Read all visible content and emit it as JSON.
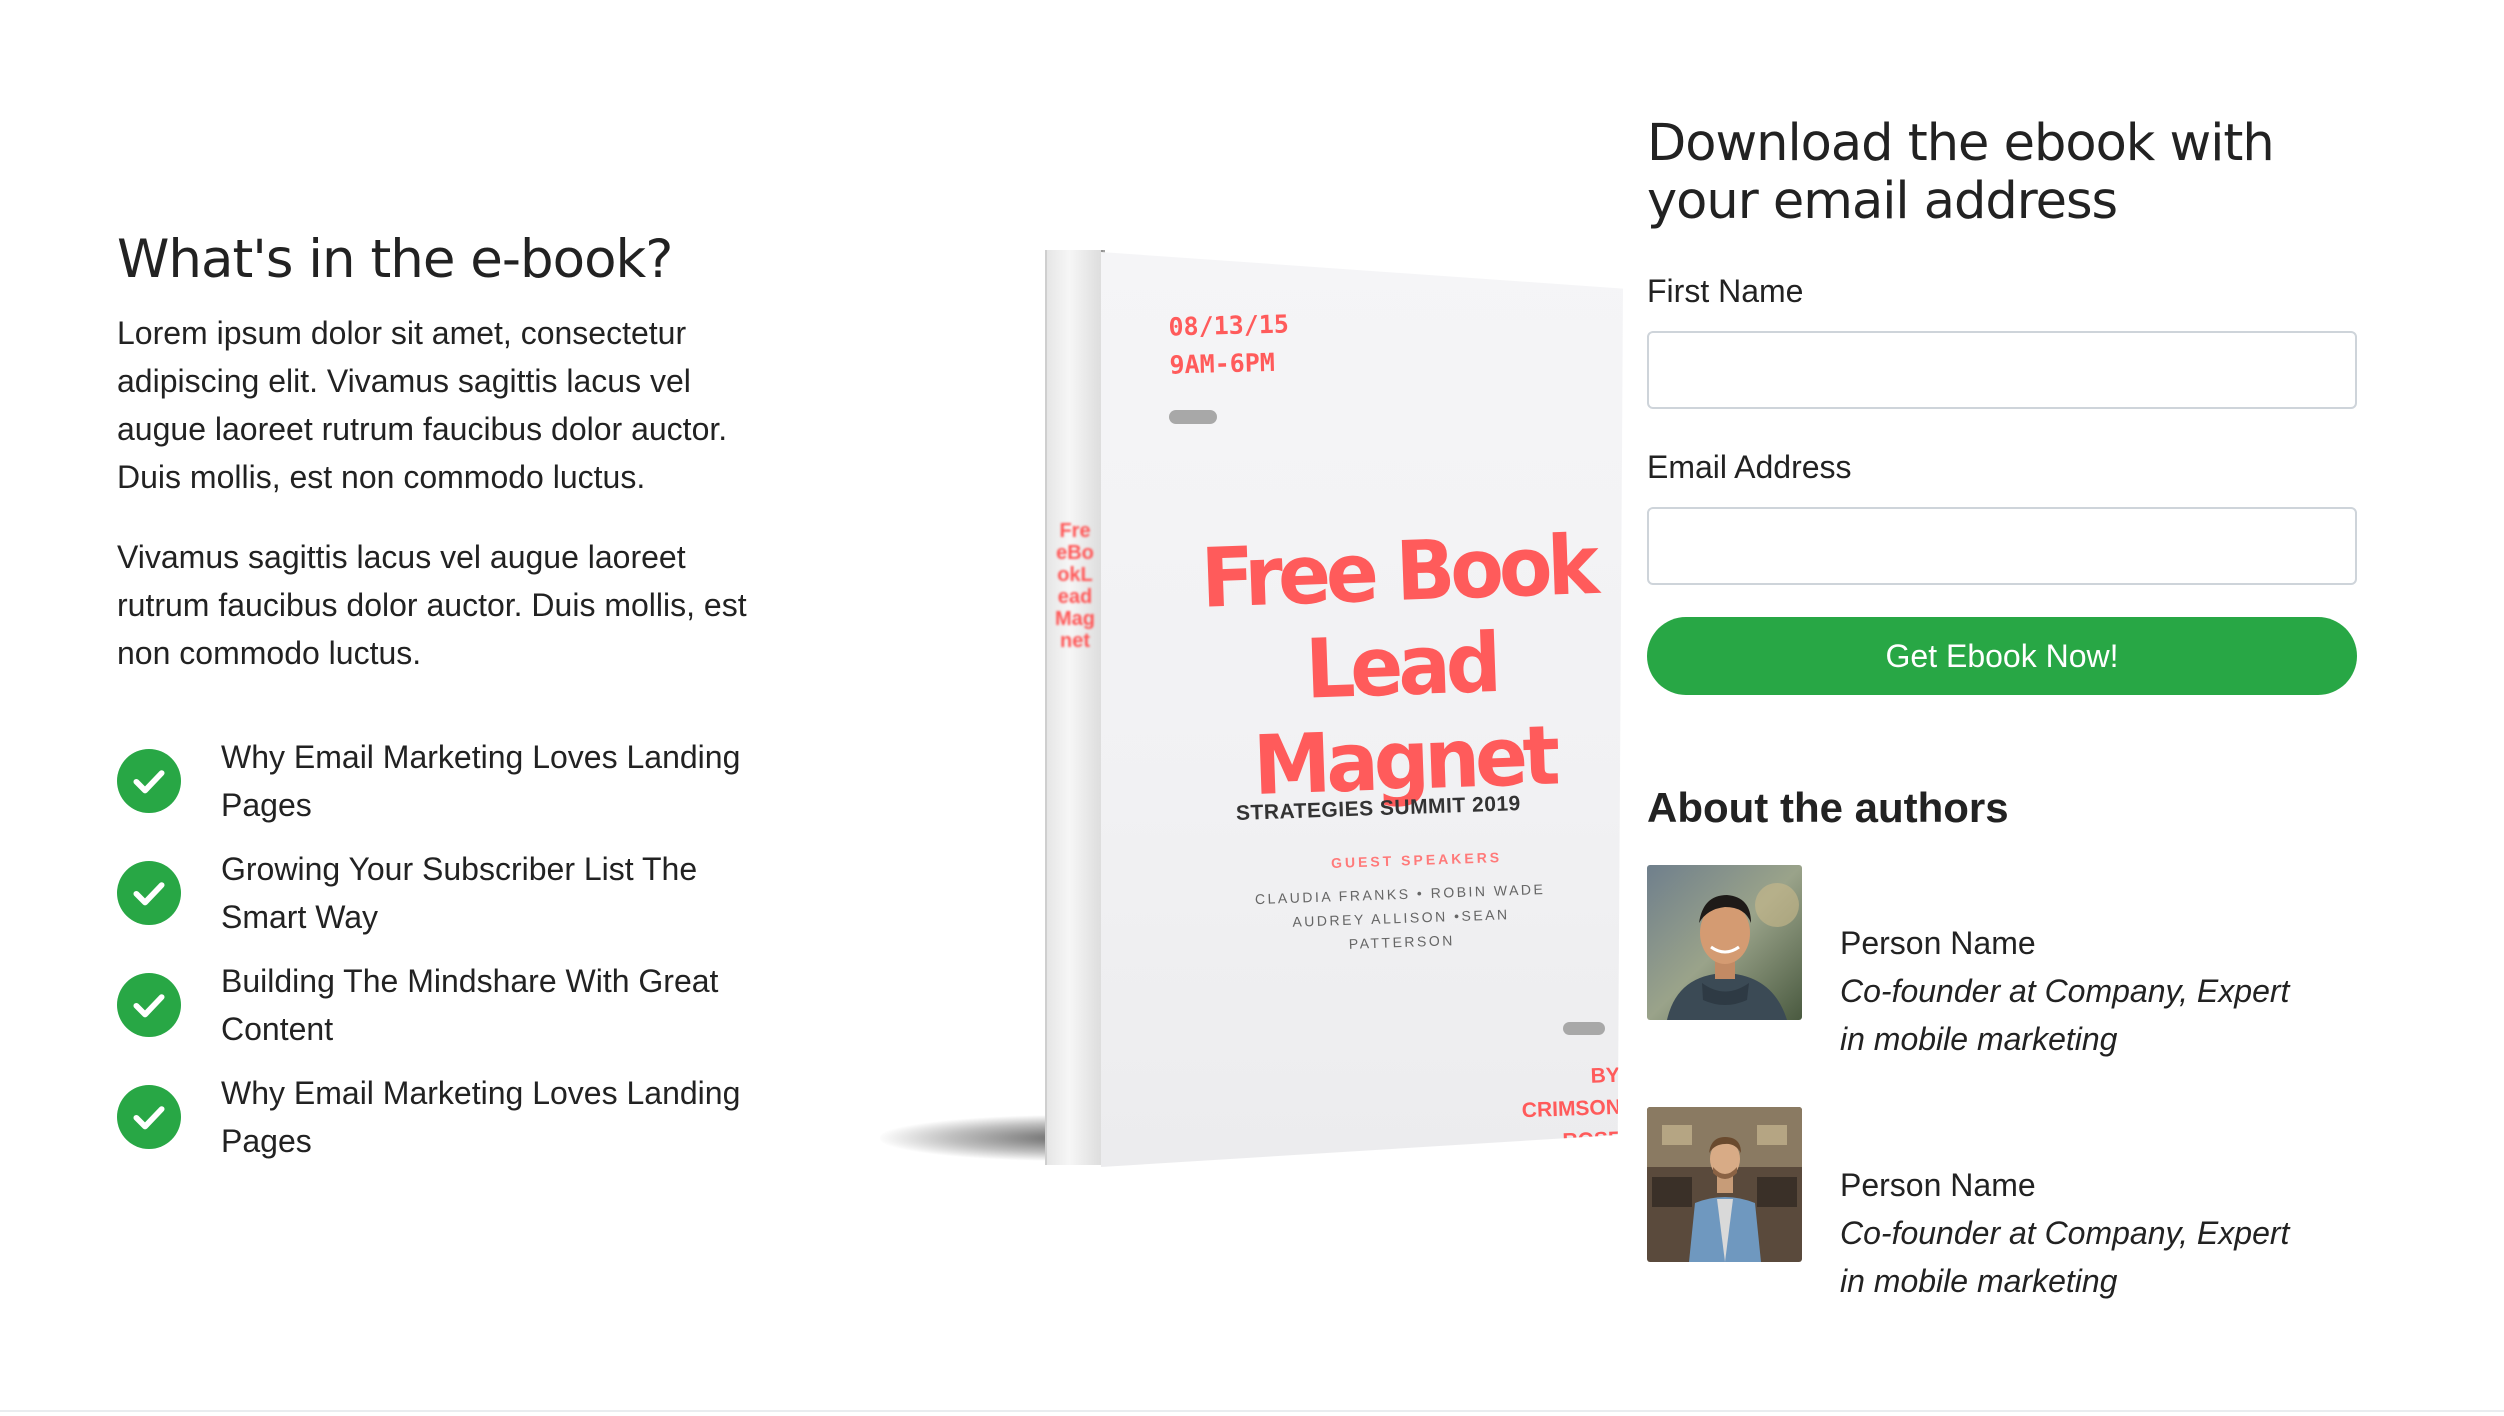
{
  "intro": {
    "title": "What's in the e-book?",
    "paragraph1": "Lorem ipsum dolor sit amet, consectetur adipiscing elit. Vivamus sagittis lacus vel augue laoreet rutrum faucibus dolor auctor. Duis mollis, est non commodo luctus.",
    "paragraph2": "Vivamus sagittis lacus vel augue laoreet rutrum faucibus dolor auctor. Duis mollis, est non commodo luctus."
  },
  "features": [
    {
      "label": "Why Email Marketing Loves Landing Pages",
      "icon": "check-circle-icon"
    },
    {
      "label": "Growing Your Subscriber List The Smart Way",
      "icon": "check-circle-icon"
    },
    {
      "label": "Building The Mindshare With Great Content",
      "icon": "check-circle-icon"
    },
    {
      "label": "Why Email Marketing Loves Landing Pages",
      "icon": "check-circle-icon"
    }
  ],
  "book": {
    "date": "08/13/15",
    "time": "9AM-6PM",
    "title_line1": "Free Book",
    "title_line2": "Lead Magnet",
    "event": "STRATEGIES SUMMIT 2019",
    "speakers_heading": "GUEST SPEAKERS",
    "speakers_line1": "CLAUDIA FRANKS • ROBIN WADE",
    "speakers_line2": "AUDREY ALLISON •SEAN PATTERSON",
    "author_line1": "BY CRIMSON",
    "author_line2": "ROSE"
  },
  "form": {
    "title": "Download the ebook with your email address",
    "first_name_label": "First Name",
    "first_name_value": "",
    "email_label": "Email Address",
    "email_value": "",
    "submit_label": "Get Ebook Now!"
  },
  "authors": {
    "title": "About the authors",
    "items": [
      {
        "name": "Person Name",
        "role": "Co-founder at Company, Expert in mobile marketing"
      },
      {
        "name": "Person Name",
        "role": "Co-founder at Company, Expert in mobile marketing"
      }
    ]
  },
  "colors": {
    "accent": "#28a745",
    "book_red": "#ff5b5b",
    "text": "#222222",
    "input_border": "#ced4da"
  }
}
